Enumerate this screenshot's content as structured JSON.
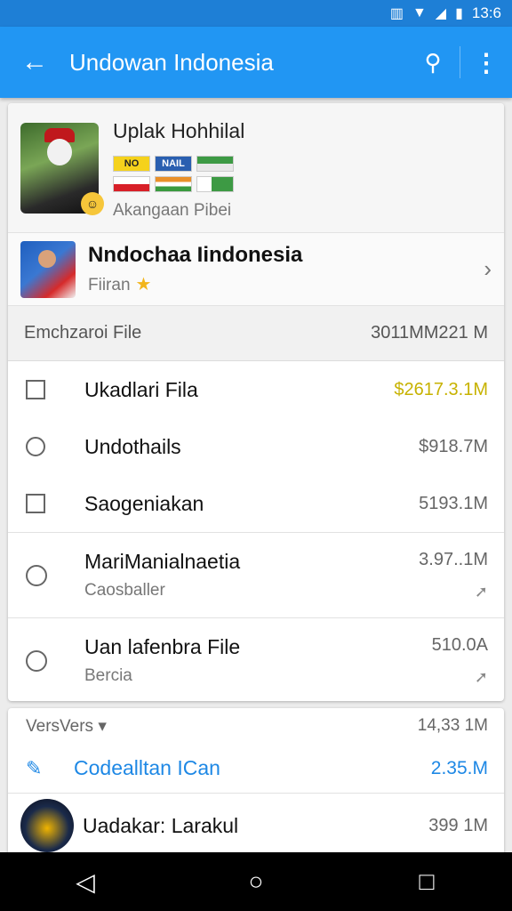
{
  "status_bar": {
    "time": "13:6"
  },
  "app_bar": {
    "title": "Undowan Indonesia"
  },
  "profile": {
    "name": "Uplak Hohhilal",
    "flags": [
      "NO",
      "NAIL",
      "",
      "",
      "",
      ""
    ],
    "subtitle": "Akangaan Pibei"
  },
  "channel": {
    "name": "Nndochaa Iindonesia",
    "subtitle": "Fiiran"
  },
  "section": {
    "label": "Emchzaroi File",
    "size": "3011MM221 M"
  },
  "files": [
    {
      "label": "Ukadlari Fila",
      "size": "$2617.3.1M"
    },
    {
      "label": "Undothails",
      "size": "$918.7M"
    },
    {
      "label": "Saogeniakan",
      "size": "5193.1M"
    }
  ],
  "detail_rows": [
    {
      "label": "MariManialnaetia",
      "sub": "Caosballer",
      "size": "3.97..1M"
    },
    {
      "label": "Uan lafenbra File",
      "sub": "Bercia",
      "size": "510.0A"
    }
  ],
  "card2": {
    "head_label": "VersVers",
    "head_size": "14,33 1M",
    "blue_label": "Codealltan ICan",
    "blue_size": "2.35.M",
    "last_label": "Uadakar: Larakul",
    "last_size": "399 1M"
  }
}
